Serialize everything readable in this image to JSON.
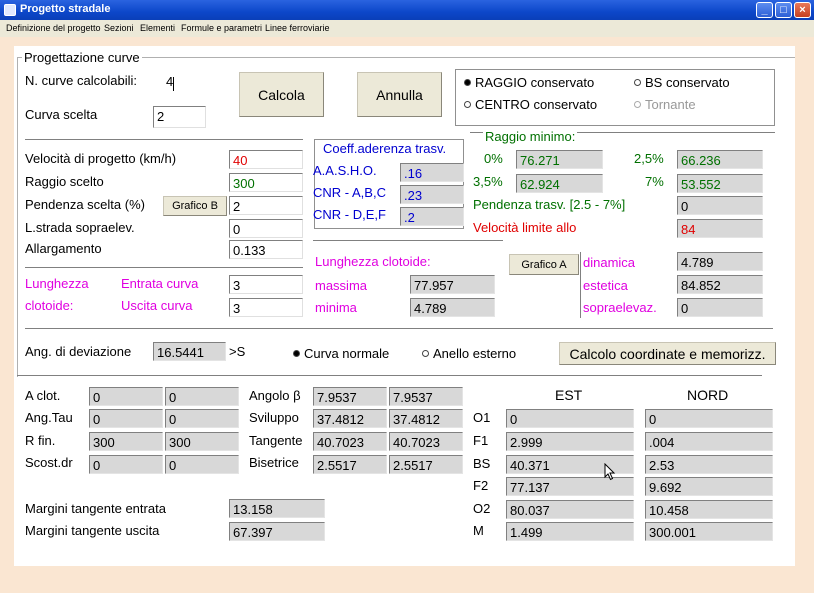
{
  "window": {
    "title": "Progetto stradale",
    "btn_min": "_",
    "btn_max": "□",
    "btn_close": "×"
  },
  "menu": [
    "Definizione del progetto",
    "Sezioni",
    "Elementi",
    "Formule e parametri",
    "Linee ferroviarie"
  ],
  "group_title": "Progettazione curve",
  "top": {
    "n_curve_label": "N. curve calcolabili:",
    "n_curve_value": "4",
    "curva_label": "Curva scelta",
    "curva_value": "2",
    "calcola": "Calcola",
    "annulla": "Annulla",
    "radio_raggio": "RAGGIO conservato",
    "radio_bs": "BS conservato",
    "radio_centro": "CENTRO conservato",
    "radio_tornante": "Tornante"
  },
  "design": {
    "velocita_label": "Velocità di progetto (km/h)",
    "velocita_value": "40",
    "raggio_label": "Raggio scelto",
    "raggio_value": "300",
    "pendenza_label": "Pendenza scelta (%)",
    "pendenza_value": "2",
    "grafico_b": "Grafico B",
    "lstrada_label": "L.strada sopraelev.",
    "lstrada_value": "0",
    "allargamento_label": "Allargamento",
    "allargamento_value": "0.133"
  },
  "clotoide_in": {
    "label1": "Lunghezza",
    "label2": "clotoide:",
    "entrata_label": "Entrata curva",
    "entrata_value": "3",
    "uscita_label": "Uscita  curva",
    "uscita_value": "3"
  },
  "coeff": {
    "title": "Coeff.aderenza trasv.",
    "rows": [
      {
        "label": "A.A.S.H.O.",
        "value": ".16"
      },
      {
        "label": "CNR - A,B,C",
        "value": ".23"
      },
      {
        "label": "CNR - D,E,F",
        "value": ".2"
      }
    ]
  },
  "raggio_min": {
    "title": "Raggio minimo:",
    "r0_label": "0%",
    "r0_value": "76.271",
    "r25_label": "2,5%",
    "r25_value": "66.236",
    "r35_label": "3,5%",
    "r35_value": "62.924",
    "r7_label": "7%",
    "r7_value": "53.552",
    "pendenza_label": "Pendenza trasv. [2.5 - 7%]",
    "pendenza_value": "0",
    "vel_label": "Velocità limite allo",
    "vel_value": "84"
  },
  "lung_clot": {
    "title": "Lunghezza clotoide:",
    "massima_label": "massima",
    "massima_value": "77.957",
    "minima_label": "minima",
    "minima_value": "4.789",
    "grafico_a": "Grafico A",
    "dinamica_label": "dinamica",
    "dinamica_value": "4.789",
    "estetica_label": "estetica",
    "estetica_value": "84.852",
    "sopra_label": "sopraelevaz.",
    "sopra_value": "0"
  },
  "deviazione": {
    "label": "Ang. di deviazione",
    "value": "16.5441",
    "unit": ">S",
    "radio_normale": "Curva normale",
    "radio_anello": "Anello esterno",
    "calcolo_btn": "Calcolo coordinate e memorizz."
  },
  "results_left": [
    {
      "label": "A clot.",
      "v1": "0",
      "v2": "0"
    },
    {
      "label": "Ang.Tau",
      "v1": "0",
      "v2": "0"
    },
    {
      "label": "R fin.",
      "v1": "300",
      "v2": "300"
    },
    {
      "label": "Scost.dr",
      "v1": "0",
      "v2": "0"
    }
  ],
  "results_mid": [
    {
      "label": "Angolo β",
      "v1": "7.9537",
      "v2": "7.9537"
    },
    {
      "label": "Sviluppo",
      "v1": "37.4812",
      "v2": "37.4812"
    },
    {
      "label": "Tangente",
      "v1": "40.7023",
      "v2": "40.7023"
    },
    {
      "label": "Bisetrice",
      "v1": "2.5517",
      "v2": "2.5517"
    }
  ],
  "coords": {
    "est_header": "EST",
    "nord_header": "NORD",
    "rows": [
      {
        "label": "O1",
        "est": "0",
        "nord": "0"
      },
      {
        "label": "F1",
        "est": "2.999",
        "nord": ".004"
      },
      {
        "label": "BS",
        "est": "40.371",
        "nord": "2.53"
      },
      {
        "label": "F2",
        "est": "77.137",
        "nord": "9.692"
      },
      {
        "label": "O2",
        "est": "80.037",
        "nord": "10.458"
      },
      {
        "label": "M",
        "est": "1.499",
        "nord": "300.001"
      }
    ]
  },
  "margini": {
    "entrata_label": "Margini tangente entrata",
    "entrata_value": "13.158",
    "uscita_label": "Margini tangente uscita",
    "uscita_value": "67.397"
  }
}
